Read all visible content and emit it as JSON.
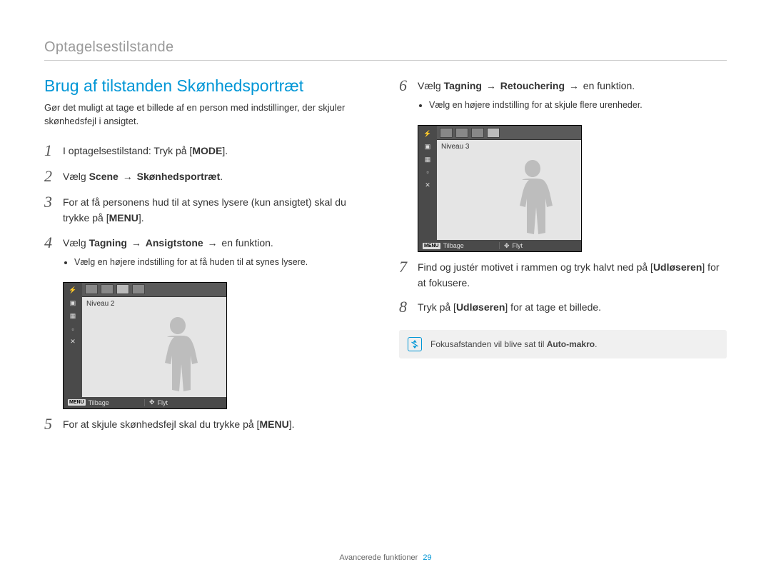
{
  "header": {
    "section": "Optagelsestilstande"
  },
  "left": {
    "title": "Brug af tilstanden Skønhedsportræt",
    "intro": "Gør det muligt at tage et billede af en person med indstillinger, der skjuler skønhedsfejl i ansigtet.",
    "step1": {
      "num": "1",
      "pre": "I optagelsestilstand: Tryk på [",
      "btn": "MODE",
      "post": "]."
    },
    "step2": {
      "num": "2",
      "pre": "Vælg ",
      "b1": "Scene",
      "arrow": "→",
      "b2": "Skønhedsportræt",
      "post": "."
    },
    "step3": {
      "num": "3",
      "line1": "For at få personens hud til at synes lysere (kun ansigtet) skal du trykke på [",
      "btn": "MENU",
      "post": "]."
    },
    "step4": {
      "num": "4",
      "pre": "Vælg ",
      "b1": "Tagning",
      "arrow": "→",
      "b2": "Ansigtstone",
      "arrow2": "→",
      "post": " en funktion.",
      "bullet": "Vælg en højere indstilling for at få huden til at synes lysere."
    },
    "screenshot": {
      "level": "Niveau 2",
      "backKey": "MENU",
      "back": "Tilbage",
      "move": "Flyt"
    },
    "step5": {
      "num": "5",
      "pre": "For at skjule skønhedsfejl skal du trykke på [",
      "btn": "MENU",
      "post": "]."
    }
  },
  "right": {
    "step6": {
      "num": "6",
      "pre": "Vælg ",
      "b1": "Tagning",
      "arrow": "→",
      "b2": "Retouchering",
      "arrow2": "→",
      "post": " en funktion.",
      "bullet": "Vælg en højere indstilling for at skjule flere urenheder."
    },
    "screenshot": {
      "level": "Niveau 3",
      "backKey": "MENU",
      "back": "Tilbage",
      "move": "Flyt"
    },
    "step7": {
      "num": "7",
      "line1": "Find og justér motivet i rammen og tryk halvt ned på [",
      "btn": "Udløseren",
      "post": "] for at fokusere."
    },
    "step8": {
      "num": "8",
      "pre": "Tryk på [",
      "btn": "Udløseren",
      "post": "] for at tage et billede."
    },
    "note": {
      "text_pre": "Fokusafstanden vil blive sat til ",
      "bold": "Auto-makro",
      "text_post": "."
    }
  },
  "footer": {
    "text": "Avancerede funktioner",
    "page": "29"
  }
}
